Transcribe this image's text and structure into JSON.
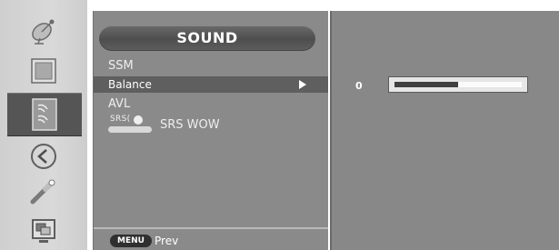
{
  "rail": {
    "items": [
      {
        "name": "picture-satellite-icon",
        "selected": false
      },
      {
        "name": "screen-icon",
        "selected": false
      },
      {
        "name": "sound-speaker-icon",
        "selected": true
      },
      {
        "name": "arrow-left-circle-icon",
        "selected": false
      },
      {
        "name": "settings-wrench-icon",
        "selected": false
      },
      {
        "name": "pip-icon",
        "selected": false
      }
    ]
  },
  "menu": {
    "title": "SOUND",
    "items": [
      {
        "label": "SSM"
      },
      {
        "label": "Balance"
      },
      {
        "label": "AVL"
      }
    ],
    "srs": {
      "badge_text": "SRS(",
      "label": "SRS WOW"
    },
    "footer": {
      "key_label": "MENU",
      "action_label": "Prev"
    }
  },
  "panel": {
    "value_label": "0",
    "balance_level_fraction": 0.5
  },
  "colors": {
    "menu_bg": "#8a8a8a",
    "highlight_bg": "#5f5f5f",
    "rail_selected_bg": "#555555"
  }
}
